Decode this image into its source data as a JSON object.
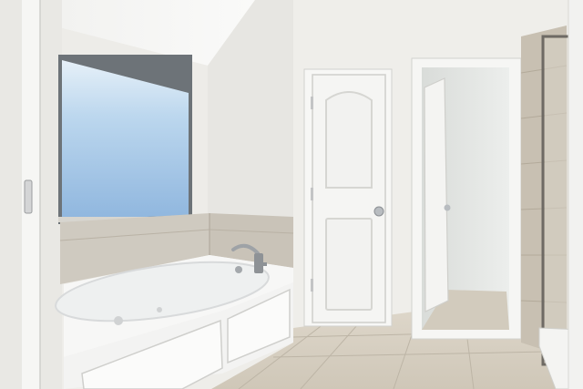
{
  "scene": {
    "kind": "photo",
    "subject": "bathroom",
    "palette": {
      "wall": "#eeede9",
      "wall_shadow": "#d9d8d3",
      "ceiling": "#f4f4f2",
      "tile_surround": "#cfcac0",
      "floor": "#d8d1c4",
      "floor_grout": "#bdb5a6",
      "door": "#f5f5f3",
      "door_panel_shadow": "#dcdcd8",
      "window_glass": "#a9c9e6",
      "window_frame": "#6d7378",
      "tub": "#f7f7f6",
      "shower_tile": "#c8c0b2",
      "fixture_metal": "#9ea2a6"
    },
    "icons": {
      "faucet": "faucet-icon",
      "door_knob": "door-knob-icon",
      "hinge": "hinge-icon"
    }
  }
}
